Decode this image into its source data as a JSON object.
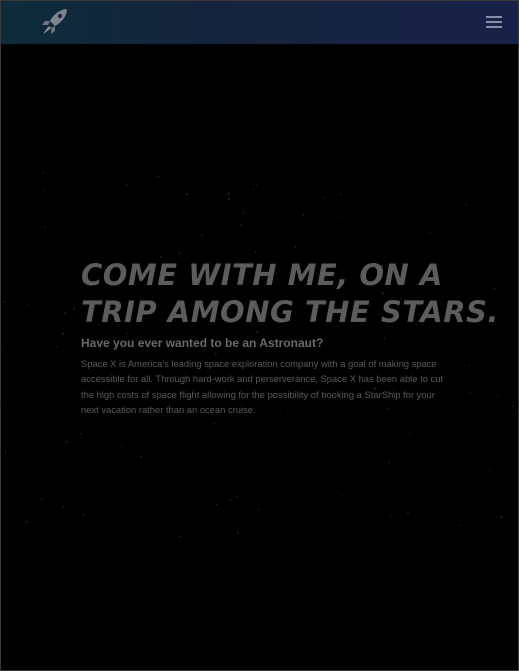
{
  "navbar": {
    "logo_icon": "rocket-icon",
    "menu_icon": "hamburger-menu-icon",
    "accent_gradient": [
      "#0d2c3a",
      "#182248"
    ]
  },
  "hero": {
    "title_line_1": "COME WITH ME, ON A",
    "title_line_2": "TRIP AMONG THE STARS.",
    "subheading": "Have you ever wanted to be an Astronaut?",
    "body": "Space X is America's leading space exploration company with a goal of making space accessible for all. Through hard-work and perserverance, Space X has been able to cut the high costs of space flight allowing for the possibility of booking a StarShip for your next vacation rather than an ocean cruise."
  },
  "colors": {
    "background": "#000000",
    "title": "#5c5c5c",
    "text": "#5a5a5a"
  }
}
